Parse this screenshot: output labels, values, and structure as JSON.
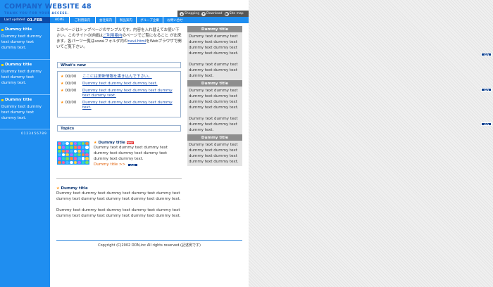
{
  "header": {
    "logo_title": "COMPANY WEBSITE 48",
    "logo_subtitle": "THANK YOU FOR YOUR ACCESS.",
    "utility_links": [
      {
        "label": "Shopping",
        "icon": "shopping-icon"
      },
      {
        "label": "Download",
        "icon": "download-icon"
      },
      {
        "label": "Site map",
        "icon": "sitemap-icon"
      }
    ]
  },
  "last_updated": {
    "label": "Last updated",
    "date": "01.FEB"
  },
  "nav": {
    "items": [
      "HOME",
      "ご利用案内",
      "会社案内",
      "製品案内",
      "グループ企業",
      "お問い合せ"
    ]
  },
  "sidebar": {
    "boxes": [
      {
        "title": "Dummy title",
        "text": "Dummy text dummy text dummy text dummy text.",
        "go": "GO"
      },
      {
        "title": "Dummy title",
        "text": "Dummy text dummy text dummy text dummy text.",
        "go": "GO"
      },
      {
        "title": "Dummy title",
        "text": "Dummy text dummy text dummy text dummy text.",
        "go": "GO"
      }
    ],
    "numbers": "0123456789"
  },
  "intro": {
    "text1": "このページはトップページのサンプルです。内容を入れ替えてお使い下さい。このサイトの詳細は",
    "link1": "ご利用案内",
    "text2": "のページでご覧になること が出来ます。各パーツ一覧はsozaiフォルダ内の",
    "link2": "navi.html",
    "text3": "をWebブラウザで開いてご覧下さい。"
  },
  "whats_new": {
    "heading": "What's new",
    "items": [
      {
        "date": "00/00",
        "text": "ここには更新情報を書き込んで下さい。"
      },
      {
        "date": "00/00",
        "text": "Dummy text dummy text dummy text."
      },
      {
        "date": "00/00",
        "text": "Dummy text dummy text dummy text dummy text dummy text."
      },
      {
        "date": "00/00",
        "text": "Dummy text dummy text dummy text dummy text."
      }
    ]
  },
  "topics": {
    "heading": "Topics",
    "topic1": {
      "title": "Dummy title",
      "new_badge": "NEW",
      "text": "Dummy text dummy text dummy text dummy text dummy text dummy text dummy text dummy text.",
      "more": "Dummy title >>",
      "go": "GO"
    },
    "topic2": {
      "title": "Dummy title",
      "text1": "Dummy text dummy text dummy text dummy text dummy text dummy text dummy text dummy text dummy text dummy text.",
      "text2": "Dummy text dummy text dummy text dummy text dummy text dummy text dummy text dummy text dummy text dummy text."
    }
  },
  "right_column": {
    "boxes": [
      {
        "title": "Dummy title",
        "text1": "Dummy text dummy text dummy text dummy text dummy text dummy text dummy text dummy text.",
        "text2": "Dummy text dummy text dummy text dummy text dummy text."
      },
      {
        "title": "Dummy title",
        "text1": "Dummy text dummy text dummy text dummy text dummy text dummy text dummy text dummy text.",
        "text2": "Dummy text dummy text dummy text dummy text dummy text."
      },
      {
        "title": "Dummy title",
        "text1": "Dummy text dummy text dummy text dummy text dummy text dummy text dummy text dummy text."
      }
    ]
  },
  "footer": {
    "copyright": "Copyright (C)2002 DDN,inc All rights reserved.(記述例です)"
  },
  "colors": {
    "brand_blue": "#1f8ef0",
    "dark_blue": "#0a4aa8",
    "accent_orange": "#ff8a00"
  }
}
